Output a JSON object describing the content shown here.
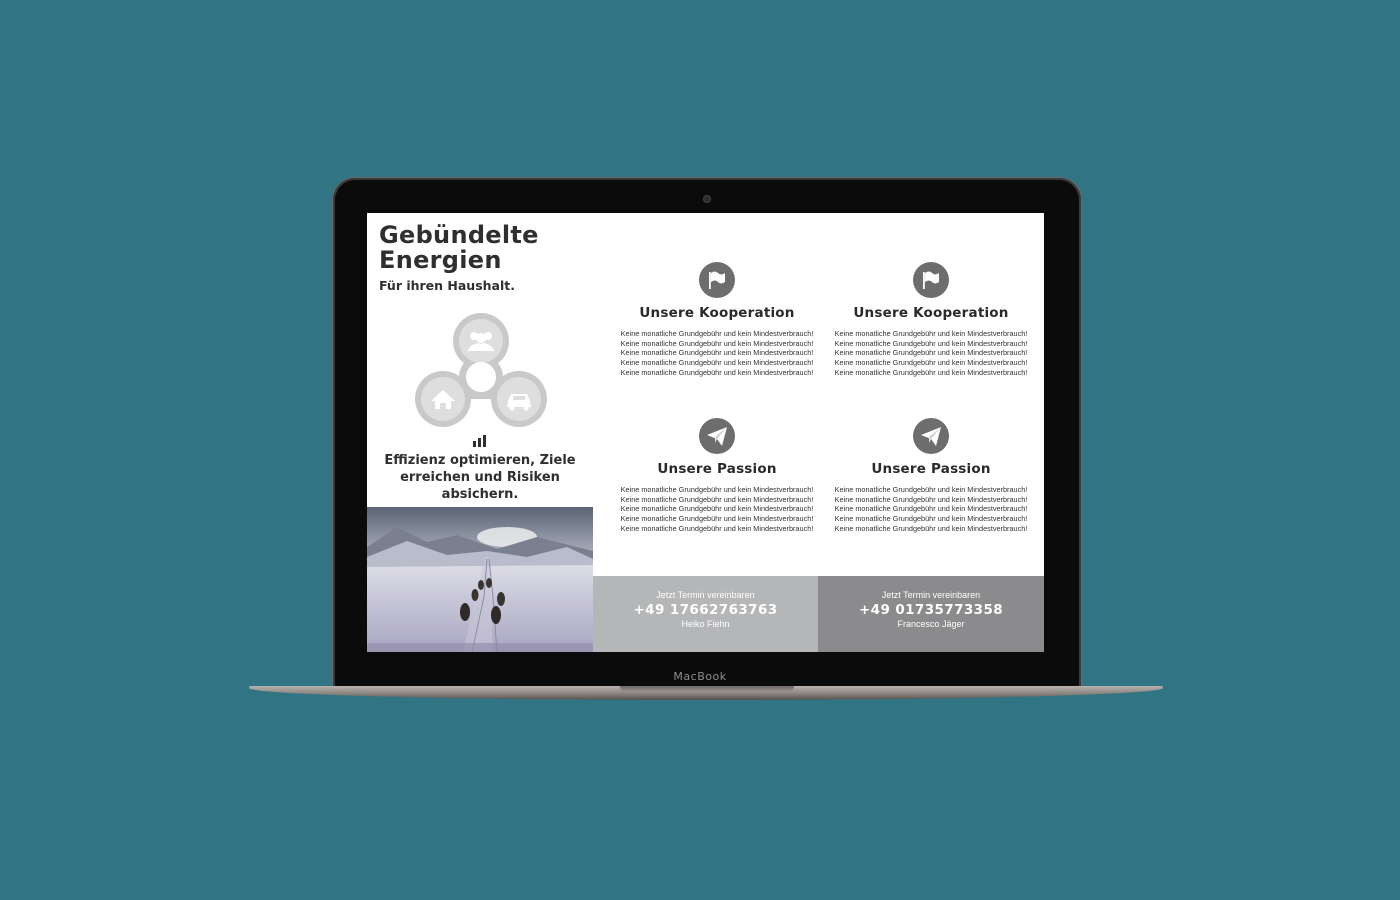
{
  "device": {
    "brand": "MacBook"
  },
  "hero": {
    "title_line1": "Gebündelte",
    "title_line2": "Energien",
    "subtitle": "Für ihren Haushalt.",
    "tagline": "Effizienz optimieren, Ziele erreichen und Risiken absichern."
  },
  "spinner_icons": [
    "people-icon",
    "home-icon",
    "car-icon"
  ],
  "features": [
    {
      "icon": "flag-icon",
      "title": "Unsere Kooperation",
      "text": "Keine monatliche Grundgebühr und kein Mindestverbrauch! Keine monatliche Grundgebühr und kein Mindestverbrauch! Keine monatliche Grundgebühr und kein Mindestverbrauch! Keine monatliche Grundgebühr und kein Mindestverbrauch! Keine monatliche Grundgebühr und kein Mindestverbrauch!"
    },
    {
      "icon": "flag-icon",
      "title": "Unsere Kooperation",
      "text": "Keine monatliche Grundgebühr und kein Mindestverbrauch! Keine monatliche Grundgebühr und kein Mindestverbrauch! Keine monatliche Grundgebühr und kein Mindestverbrauch! Keine monatliche Grundgebühr und kein Mindestverbrauch! Keine monatliche Grundgebühr und kein Mindestverbrauch!"
    },
    {
      "icon": "paper-plane-icon",
      "title": "Unsere Passion",
      "text": "Keine monatliche Grundgebühr und kein Mindestverbrauch! Keine monatliche Grundgebühr und kein Mindestverbrauch! Keine monatliche Grundgebühr und kein Mindestverbrauch! Keine monatliche Grundgebühr und kein Mindestverbrauch! Keine monatliche Grundgebühr und kein Mindestverbrauch!"
    },
    {
      "icon": "paper-plane-icon",
      "title": "Unsere Passion",
      "text": "Keine monatliche Grundgebühr und kein Mindestverbrauch! Keine monatliche Grundgebühr und kein Mindestverbrauch! Keine monatliche Grundgebühr und kein Mindestverbrauch! Keine monatliche Grundgebühr und kein Mindestverbrauch! Keine monatliche Grundgebühr und kein Mindestverbrauch!"
    }
  ],
  "contacts": [
    {
      "label": "Jetzt Termin vereinbaren",
      "phone": "+49 17662763763",
      "name": "Heiko Fiehn"
    },
    {
      "label": "Jetzt Termin vereinbaren",
      "phone": "+49 01735773358",
      "name": "Francesco Jäger"
    }
  ],
  "colors": {
    "background": "#317584",
    "text_dark": "#2f2f2f",
    "icon_circle": "#6d6d6d",
    "contact_light": "#b5b6b8",
    "contact_dark": "#8b8b8d"
  }
}
